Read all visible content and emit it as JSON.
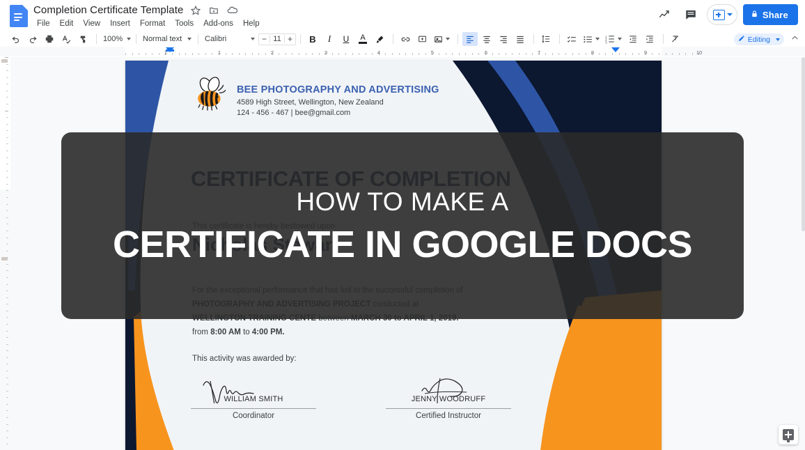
{
  "app": {
    "doc_title": "Completion Certificate Template",
    "logo_icon": "google-docs-icon",
    "title_icons": [
      "star-icon",
      "move-to-folder-icon",
      "cloud-saved-icon"
    ],
    "menu": [
      "File",
      "Edit",
      "View",
      "Insert",
      "Format",
      "Tools",
      "Add-ons",
      "Help"
    ],
    "header_actions": {
      "activity_icon": "activity-dashboard-icon",
      "comments_icon": "comment-history-icon",
      "present_label": "",
      "share_label": "Share",
      "share_icon": "lock-icon",
      "share_color": "#1a73e8"
    }
  },
  "toolbar": {
    "left_icons": [
      "undo-icon",
      "redo-icon",
      "print-icon",
      "spelling-check-icon",
      "paint-format-icon"
    ],
    "zoom_value": "100%",
    "style_value": "Normal text",
    "font_value": "Calibri",
    "font_size_decrease": "−",
    "font_size_value": "11",
    "font_size_increase": "+",
    "format_icons": [
      "bold-icon",
      "italic-icon",
      "underline-icon",
      "text-color-icon",
      "highlight-color-icon"
    ],
    "bold_label": "B",
    "italic_label": "I",
    "underline_label": "U",
    "text_color_label": "A",
    "insert_icons": [
      "link-icon",
      "add-comment-icon",
      "insert-image-icon"
    ],
    "align_icons": [
      "align-left-icon",
      "align-center-icon",
      "align-right-icon",
      "align-justify-icon"
    ],
    "list_icons": [
      "line-spacing-icon",
      "checklist-icon",
      "bulleted-list-icon",
      "numbered-list-icon",
      "decrease-indent-icon",
      "increase-indent-icon",
      "clear-formatting-icon"
    ],
    "mode_label": "Editing",
    "mode_icon": "pencil-icon",
    "collapse_icon": "chevron-up-icon"
  },
  "ruler": {
    "horizontal_numbers": [
      "1",
      "1",
      "2",
      "3",
      "4",
      "5",
      "6",
      "7",
      "8",
      "9",
      "10",
      "1"
    ],
    "left_indent_marker": "indent-marker",
    "right_indent_marker": "indent-marker"
  },
  "sidebar": {
    "outline_icon": "document-outline-icon"
  },
  "canvas": {
    "explore_icon": "explore-button-icon"
  },
  "certificate": {
    "org_name": "BEE PHOTOGRAPHY AND ADVERTISING",
    "org_address": "4589 High Street, Wellington, New Zealand",
    "org_contact": "124 - 456 - 467 | bee@gmail.com",
    "logo_icon": "bee-logo-icon",
    "title": "CERTIFICATE OF COMPLETION",
    "subtitle": "This certificate is hereby bestowed upon",
    "recipient": "Nicholas Stewart",
    "body_line1": "For the exceptional performance that has led to the successful completion of",
    "body_line2_bold": "PHOTOGRAPHY AND ADVERTISING PROJECT",
    "body_line2_rest": "conducted at",
    "body_line3_bold": "WELLINGTON TRAINING CENTE",
    "body_line3_mid": "between",
    "body_line3_bold2": "MARCH 30 to APRIL 1, 2019.",
    "body_line4_pre": "from",
    "body_line4_b1": "8:00 AM",
    "body_line4_mid": "to",
    "body_line4_b2": "4:00 PM.",
    "awarded_by": "This activity was awarded by:",
    "signatures": [
      {
        "name": "WILLIAM SMITH",
        "role": "Coordinator"
      },
      {
        "name": "JENNY WOODRUFF",
        "role": "Certified Instructor"
      }
    ],
    "colors": {
      "blue": "#2e55a5",
      "navy": "#0c1730",
      "orange": "#f7941e",
      "paper": "#f1f4f7",
      "heading": "#13213f"
    }
  },
  "overlay": {
    "line1": "HOW TO MAKE A",
    "line2": "CERTIFICATE IN GOOGLE DOCS",
    "background": "rgba(42,42,42,0.90)"
  }
}
